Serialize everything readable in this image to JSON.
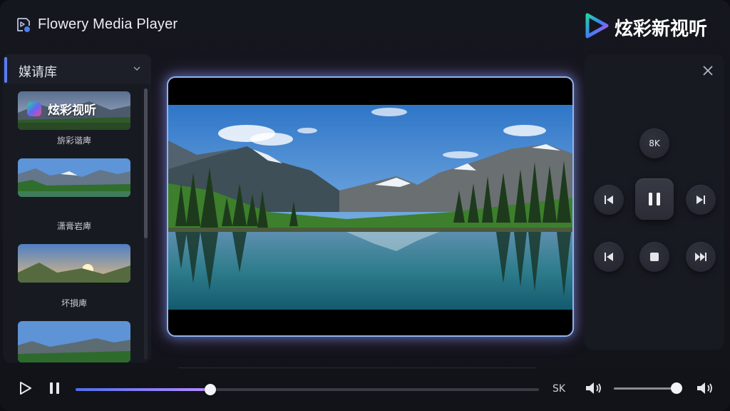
{
  "app": {
    "title": "Flowery Media Player",
    "brand": "炫彩新视听"
  },
  "sidebar": {
    "title": "媒请库",
    "items": [
      {
        "label": "旂彩谐庳",
        "overlay_text": "炫彩视听"
      },
      {
        "label": "潇膏岩庳"
      },
      {
        "label": "坏損庳"
      },
      {
        "label": ""
      }
    ]
  },
  "panel": {
    "resolution_label": "8K",
    "buttons": [
      "previous",
      "pause",
      "next",
      "previous",
      "stop",
      "fast-forward"
    ]
  },
  "playback": {
    "progress": 0.29,
    "resolution": "SK",
    "volume": 0.96
  },
  "colors": {
    "accent": "#5b7cf6",
    "progress_start": "#4f6ff0",
    "progress_end": "#b98bff",
    "frame_glow": "#8fb4f0"
  }
}
